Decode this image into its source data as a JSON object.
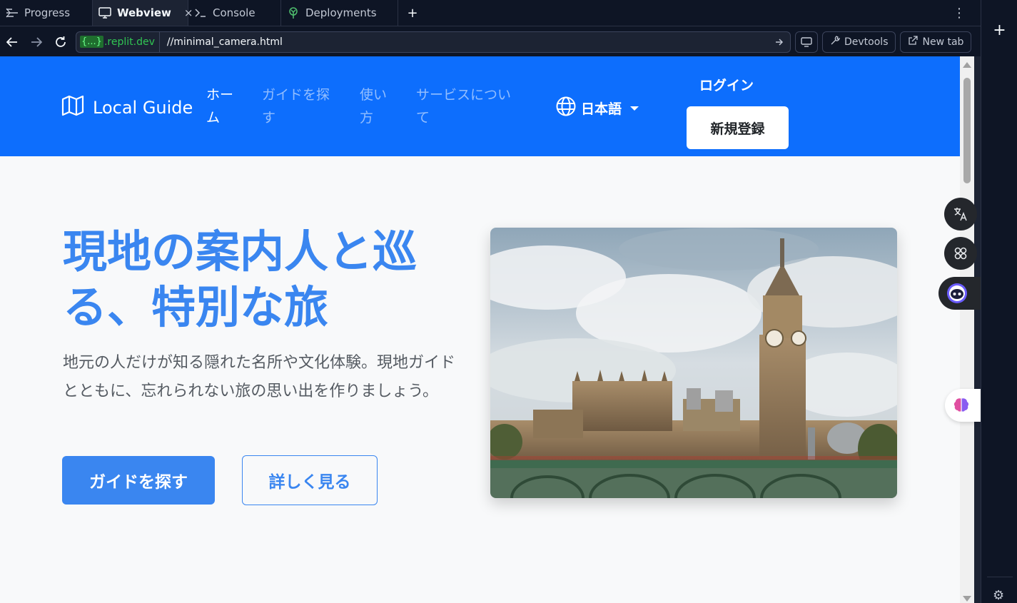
{
  "tabs": [
    {
      "label": "Progress",
      "icon": "progress-icon",
      "active": false
    },
    {
      "label": "Webview",
      "icon": "monitor-icon",
      "active": true
    },
    {
      "label": "Console",
      "icon": "terminal-icon",
      "active": false
    },
    {
      "label": "Deployments",
      "icon": "deploy-icon",
      "active": false
    }
  ],
  "tab_close": "×",
  "tab_add": "+",
  "tab_menu": "⋮",
  "url": {
    "host_tag": "{...}",
    "host": ".replit.dev",
    "path": "//minimal_camera.html"
  },
  "toolbar": {
    "devtools": "Devtools",
    "new_tab": "New tab"
  },
  "site": {
    "brand": "Local Guide",
    "nav": [
      "ホーム",
      "ガイドを探す",
      "使い方",
      "サービスについて"
    ],
    "language": "日本語",
    "login": "ログイン",
    "signup": "新規登録"
  },
  "hero": {
    "title": "現地の案内人と巡る、特別な旅",
    "text": "地元の人だけが知る隠れた名所や文化体験。現地ガイドとともに、忘れられない旅の思い出を作りましょう。",
    "primary": "ガイドを探す",
    "secondary": "詳しく見る"
  },
  "colors": {
    "nav_bg": "#0d6efd",
    "accent": "#3a86f0",
    "replit_bg": "#0e1525"
  }
}
